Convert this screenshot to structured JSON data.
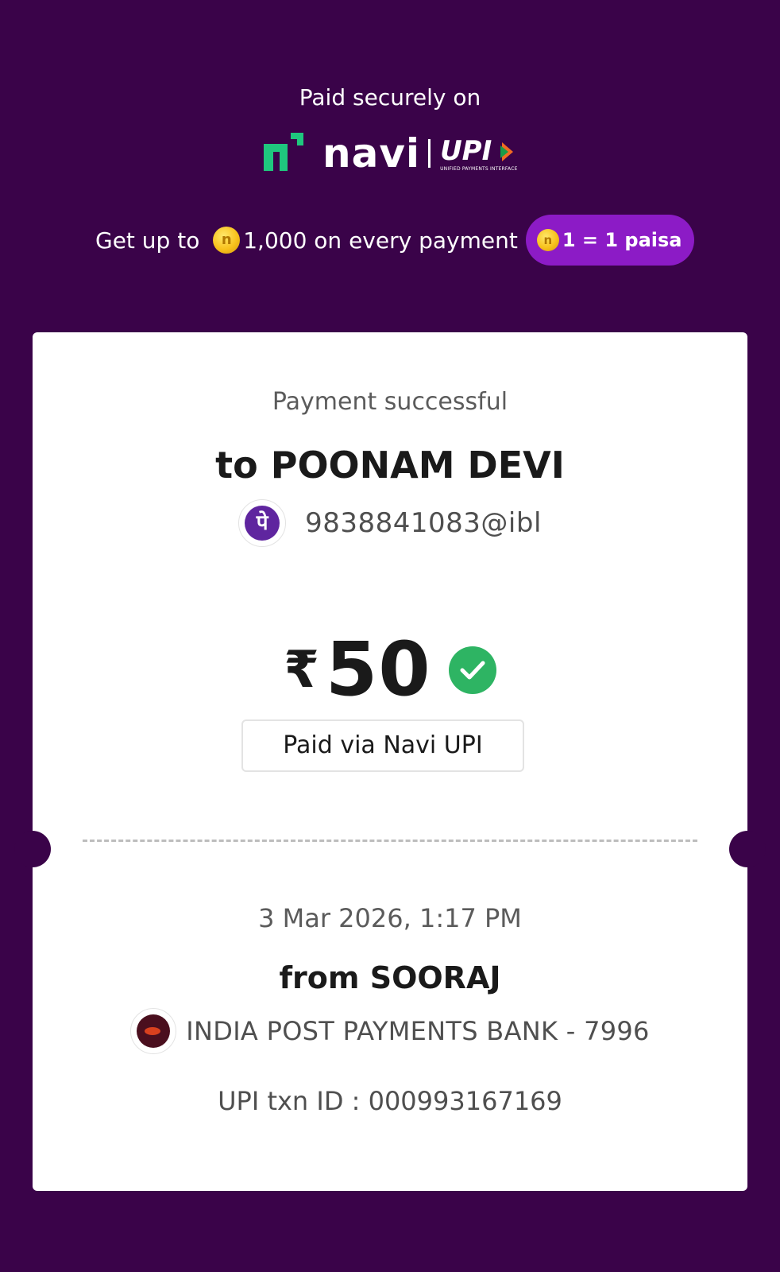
{
  "header": {
    "paid_securely": "Paid securely on",
    "brand_name": "navi",
    "upi_logo": "UPI",
    "upi_subtitle": "UNIFIED PAYMENTS INTERFACE",
    "reward_prefix": "Get up to ",
    "reward_amount": "1,000 on every payment",
    "reward_rate": "1 = 1 paisa"
  },
  "receipt": {
    "status": "Payment successful",
    "payee_name": "to POONAM DEVI",
    "payee_app_glyph": "पे",
    "payee_vpa": "9838841083@ibl",
    "currency_symbol": "₹",
    "amount": "50",
    "paid_via": "Paid via Navi UPI",
    "datetime": "3 Mar 2026, 1:17 PM",
    "payer_name": "from SOORAJ",
    "payer_bank": "INDIA POST PAYMENTS BANK - 7996",
    "txn_id": "UPI txn ID : 000993167169"
  },
  "icons": {
    "navi_logo": "navi-logo-icon",
    "coin": "coin-icon",
    "phonepe": "phonepe-icon",
    "success": "check-circle-icon",
    "bank": "india-post-bank-icon"
  },
  "colors": {
    "background": "#3a0349",
    "navi_green": "#1fc77e",
    "pill": "#8c1bc6",
    "success_green": "#2eb463",
    "phonepe_purple": "#5f259f"
  }
}
